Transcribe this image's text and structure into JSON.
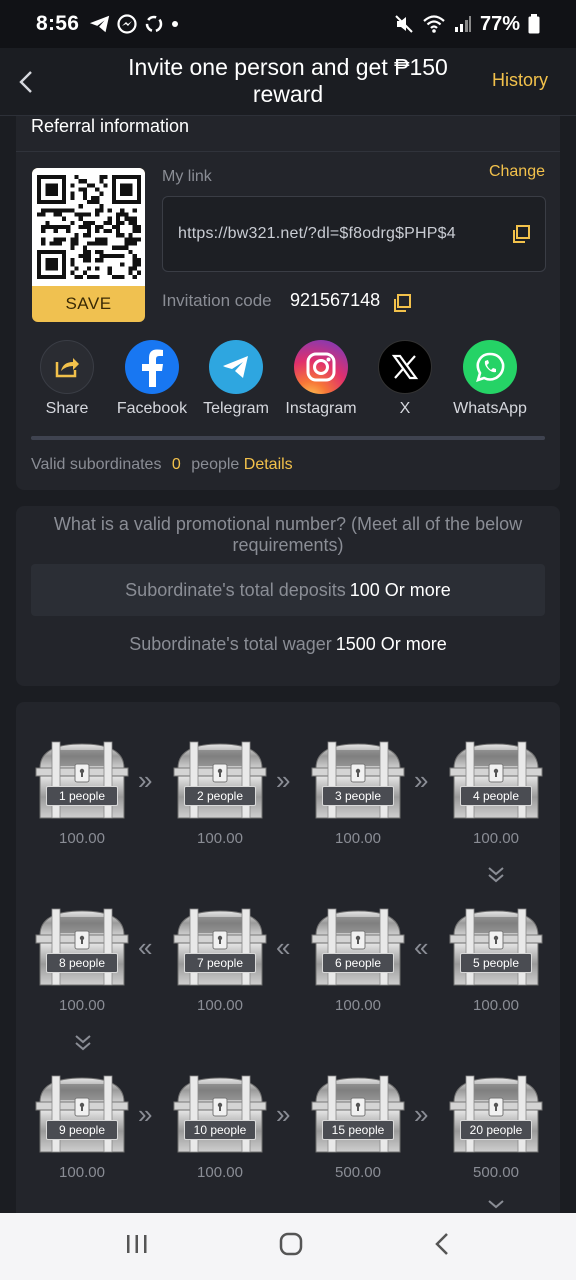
{
  "status": {
    "time": "8:56",
    "battery": "77%"
  },
  "header": {
    "title": "Invite one person and get ₱150 reward",
    "history": "History"
  },
  "referral": {
    "title": "Referral information",
    "save_label": "SAVE",
    "mylink_label": "My link",
    "change_label": "Change",
    "link": "https://bw321.net/?dl=$f8odrg$PHP$4",
    "invitation_label": "Invitation code",
    "invitation_code": "921567148",
    "share_items": [
      {
        "label": "Share",
        "icon": "share-icon"
      },
      {
        "label": "Facebook",
        "icon": "facebook-icon"
      },
      {
        "label": "Telegram",
        "icon": "telegram-icon"
      },
      {
        "label": "Instagram",
        "icon": "instagram-icon"
      },
      {
        "label": "X",
        "icon": "x-icon"
      },
      {
        "label": "WhatsApp",
        "icon": "whatsapp-icon"
      }
    ],
    "valid_label": "Valid subordinates",
    "valid_count": "0",
    "valid_unit": "people",
    "details_label": "Details"
  },
  "requirements": {
    "title": "What is a valid promotional number? (Meet all of the below requirements)",
    "rows": [
      {
        "label": "Subordinate's total deposits",
        "value": "100 Or more"
      },
      {
        "label": "Subordinate's total wager",
        "value": "1500 Or more"
      }
    ]
  },
  "chests": [
    {
      "people": "1 people",
      "amount": "100.00"
    },
    {
      "people": "2 people",
      "amount": "100.00"
    },
    {
      "people": "3 people",
      "amount": "100.00"
    },
    {
      "people": "4 people",
      "amount": "100.00"
    },
    {
      "people": "5 people",
      "amount": "100.00"
    },
    {
      "people": "6 people",
      "amount": "100.00"
    },
    {
      "people": "7 people",
      "amount": "100.00"
    },
    {
      "people": "8 people",
      "amount": "100.00"
    },
    {
      "people": "9 people",
      "amount": "100.00"
    },
    {
      "people": "10 people",
      "amount": "100.00"
    },
    {
      "people": "15 people",
      "amount": "500.00"
    },
    {
      "people": "20 people",
      "amount": "500.00"
    }
  ],
  "colors": {
    "accent": "#f2c14b",
    "background": "#1b1d22",
    "card": "#23252b"
  }
}
